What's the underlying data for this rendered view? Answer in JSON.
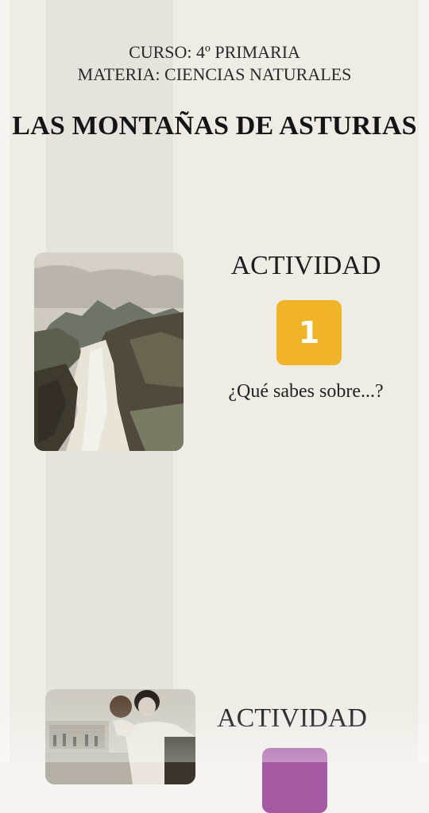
{
  "header": {
    "course": "CURSO: 4º PRIMARIA",
    "subject": "MATERIA: CIENCIAS NATURALES",
    "title": "LAS MONTAÑAS DE ASTURIAS"
  },
  "activities": [
    {
      "label": "ACTIVIDAD",
      "number": "1",
      "question": "¿Qué sabes sobre...?",
      "badge_color": "#f0b429"
    },
    {
      "label": "ACTIVIDAD",
      "number": "",
      "badge_color": "#a55aa4"
    }
  ]
}
